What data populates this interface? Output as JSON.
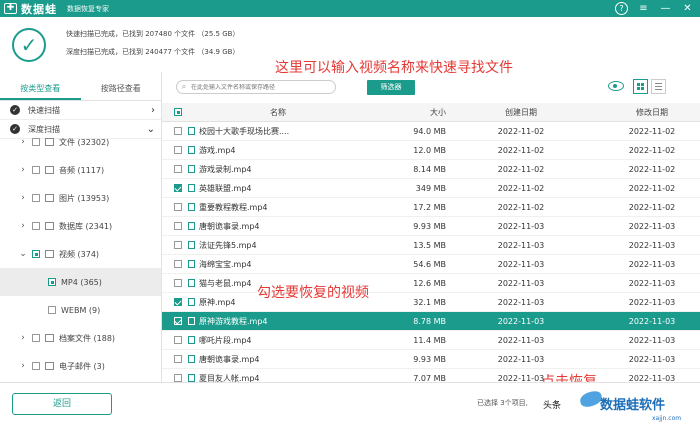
{
  "app": {
    "name": "数据蛙",
    "subtitle": "数据恢复专家",
    "logo_glyph": "✚",
    "window_buttons": [
      "?",
      "≡",
      "—",
      "✕"
    ]
  },
  "status": {
    "quick_scan": "快速扫描已完成，已找到 207480 个文件 （25.5 GB）",
    "deep_scan": "深度扫描已完成，已找到 240477 个文件 （34.9 GB）"
  },
  "annotations": {
    "search_hint": "这里可以输入视频名称来快速寻找文件",
    "select_hint": "勾选要恢复的视频",
    "recover_hint": "点击恢复"
  },
  "sidebar": {
    "tabs": [
      "按类型查看",
      "按路径查看"
    ],
    "scans": [
      "快速扫描",
      "深度扫描"
    ],
    "tree": [
      {
        "label": "文件 (32302)",
        "arrow": "›",
        "check": "off"
      },
      {
        "label": "音频 (1117)",
        "arrow": "›",
        "check": "off"
      },
      {
        "label": "图片 (13953)",
        "arrow": "›",
        "check": "off"
      },
      {
        "label": "数据库 (2341)",
        "arrow": "›",
        "check": "off"
      },
      {
        "label": "视频 (374)",
        "arrow": "⌄",
        "check": "part"
      },
      {
        "label": "MP4 (365)",
        "arrow": "",
        "check": "part",
        "selected": true
      },
      {
        "label": "WEBM (9)",
        "arrow": "",
        "check": "off"
      },
      {
        "label": "档案文件 (188)",
        "arrow": "›",
        "check": "off"
      },
      {
        "label": "电子邮件 (3)",
        "arrow": "›",
        "check": "off"
      }
    ]
  },
  "toolbar": {
    "search_placeholder": "在此处输入文件名称或保存路径",
    "filter_label": "筛选器"
  },
  "table": {
    "headers": {
      "name": "名称",
      "size": "大小",
      "created": "创建日期",
      "modified": "修改日期"
    },
    "rows": [
      {
        "name": "校园十大歌手现场比赛....",
        "size": "94.0 MB",
        "created": "2022-11-02",
        "modified": "2022-11-02",
        "checked": false,
        "highlighted": false
      },
      {
        "name": "游戏.mp4",
        "size": "12.0 MB",
        "created": "2022-11-02",
        "modified": "2022-11-02",
        "checked": false,
        "highlighted": false
      },
      {
        "name": "游戏录制.mp4",
        "size": "8.14 MB",
        "created": "2022-11-02",
        "modified": "2022-11-02",
        "checked": false,
        "highlighted": false
      },
      {
        "name": "英雄联盟.mp4",
        "size": "349 MB",
        "created": "2022-11-02",
        "modified": "2022-11-02",
        "checked": true,
        "highlighted": false
      },
      {
        "name": "重要教程教程.mp4",
        "size": "17.2 MB",
        "created": "2022-11-02",
        "modified": "2022-11-02",
        "checked": false,
        "highlighted": false
      },
      {
        "name": "唐朝诡事录.mp4",
        "size": "9.93 MB",
        "created": "2022-11-03",
        "modified": "2022-11-03",
        "checked": false,
        "highlighted": false
      },
      {
        "name": "法证先锋5.mp4",
        "size": "13.5 MB",
        "created": "2022-11-03",
        "modified": "2022-11-03",
        "checked": false,
        "highlighted": false
      },
      {
        "name": "海绵宝宝.mp4",
        "size": "54.6 MB",
        "created": "2022-11-03",
        "modified": "2022-11-03",
        "checked": false,
        "highlighted": false
      },
      {
        "name": "猫与老鼠.mp4",
        "size": "12.6 MB",
        "created": "2022-11-03",
        "modified": "2022-11-03",
        "checked": false,
        "highlighted": false
      },
      {
        "name": "原神.mp4",
        "size": "32.1 MB",
        "created": "2022-11-03",
        "modified": "2022-11-03",
        "checked": true,
        "highlighted": false
      },
      {
        "name": "原神游戏教程.mp4",
        "size": "8.78 MB",
        "created": "2022-11-03",
        "modified": "2022-11-03",
        "checked": true,
        "highlighted": true
      },
      {
        "name": "哪吒片段.mp4",
        "size": "11.4 MB",
        "created": "2022-11-03",
        "modified": "2022-11-03",
        "checked": false,
        "highlighted": false
      },
      {
        "name": "唐朝诡事录.mp4",
        "size": "9.93 MB",
        "created": "2022-11-03",
        "modified": "2022-11-03",
        "checked": false,
        "highlighted": false
      },
      {
        "name": "夏目友人帐.mp4",
        "size": "7.07 MB",
        "created": "2022-11-03",
        "modified": "2022-11-03",
        "checked": false,
        "highlighted": false
      }
    ]
  },
  "footer": {
    "back_label": "返回",
    "selected_status": "已选择 3个项目,"
  },
  "watermark": {
    "text": "数据蛙软件",
    "url": "xajjn.com",
    "small": "头条"
  },
  "colors": {
    "accent": "#1b9b8c",
    "annotation": "#e53935"
  }
}
